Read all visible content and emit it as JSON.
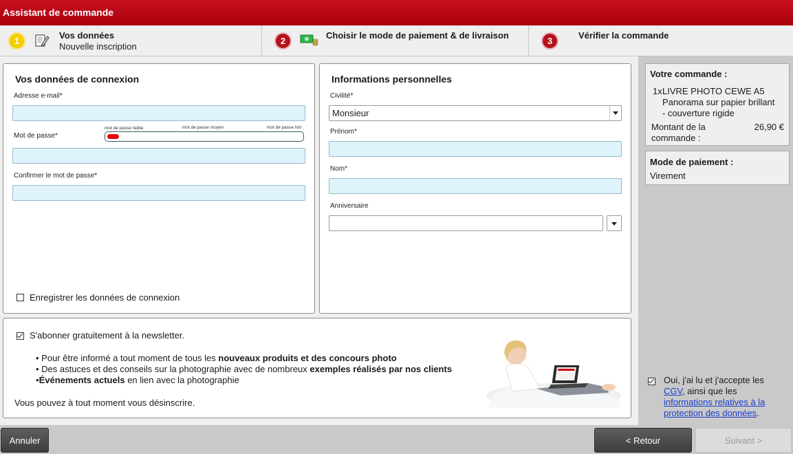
{
  "window": {
    "title": "Assistant de commande"
  },
  "steps": [
    {
      "number": "1",
      "title": "Vos données",
      "subtitle": "Nouvelle inscription"
    },
    {
      "number": "2",
      "title": "Choisir le mode de paiement & de livraison"
    },
    {
      "number": "3",
      "title": "Vérifier la commande"
    }
  ],
  "login": {
    "heading": "Vos données de connexion",
    "email_label": "Adresse e-mail*",
    "email_value": "",
    "password_label": "Mot de passe*",
    "password_value": "",
    "strength": {
      "weak": "mot de passe faible",
      "medium": "mot de passe moyen",
      "strong": "mot de passe fort",
      "level": 0.06
    },
    "confirm_label": "Confirmer le mot de passe*",
    "confirm_value": "",
    "remember_label": "Enregistrer les données de connexion",
    "remember_checked": false
  },
  "personal": {
    "heading": "Informations personnelles",
    "civility_label": "Civilité*",
    "civility_value": "Monsieur",
    "firstname_label": "Prénom*",
    "lastname_label": "Nom*",
    "birthday_label": "Anniversaire"
  },
  "newsletter": {
    "label": "S'abonner gratuitement à la newsletter.",
    "checked": true,
    "b1_pre": "• Pour être informé a tout moment de tous les ",
    "b1_bold": "nouveaux produits et des concours photo",
    "b2_pre": "• Des astuces et des conseils sur la photographie avec de nombreux ",
    "b2_bold": "exemples réalisés par nos clients",
    "b3_bold": "Événements actuels",
    "b3_post": " en lien avec la photographie",
    "b3_bullet": "•",
    "unsubscribe": "Vous pouvez à tout moment vous désinscrire."
  },
  "order": {
    "heading": "Votre commande :",
    "qty": "1x",
    "product_line1": "LIVRE PHOTO CEWE A5",
    "product_line2": "Panorama sur papier brillant",
    "product_line3": "- couverture rigide",
    "amount_label_1": "Montant de la",
    "amount_label_2": "commande :",
    "amount_value": "26,90 €"
  },
  "payment": {
    "heading": "Mode de paiement :",
    "value": "Virement"
  },
  "terms": {
    "checked": true,
    "line1": "Oui, j'ai lu et j'accepte les",
    "cgv": "CGV",
    "line2_post": ", ainsi que les",
    "link_line1": "informations relatives à la",
    "link_line2": "protection des données",
    "period": "."
  },
  "footer": {
    "cancel": "Annuler",
    "back": "< Retour",
    "next": "Suivant >"
  },
  "colors": {
    "brand": "#b8101c",
    "active_step": "#f2cf00",
    "input_bg": "#dff3fd",
    "link": "#1a3fd0"
  }
}
